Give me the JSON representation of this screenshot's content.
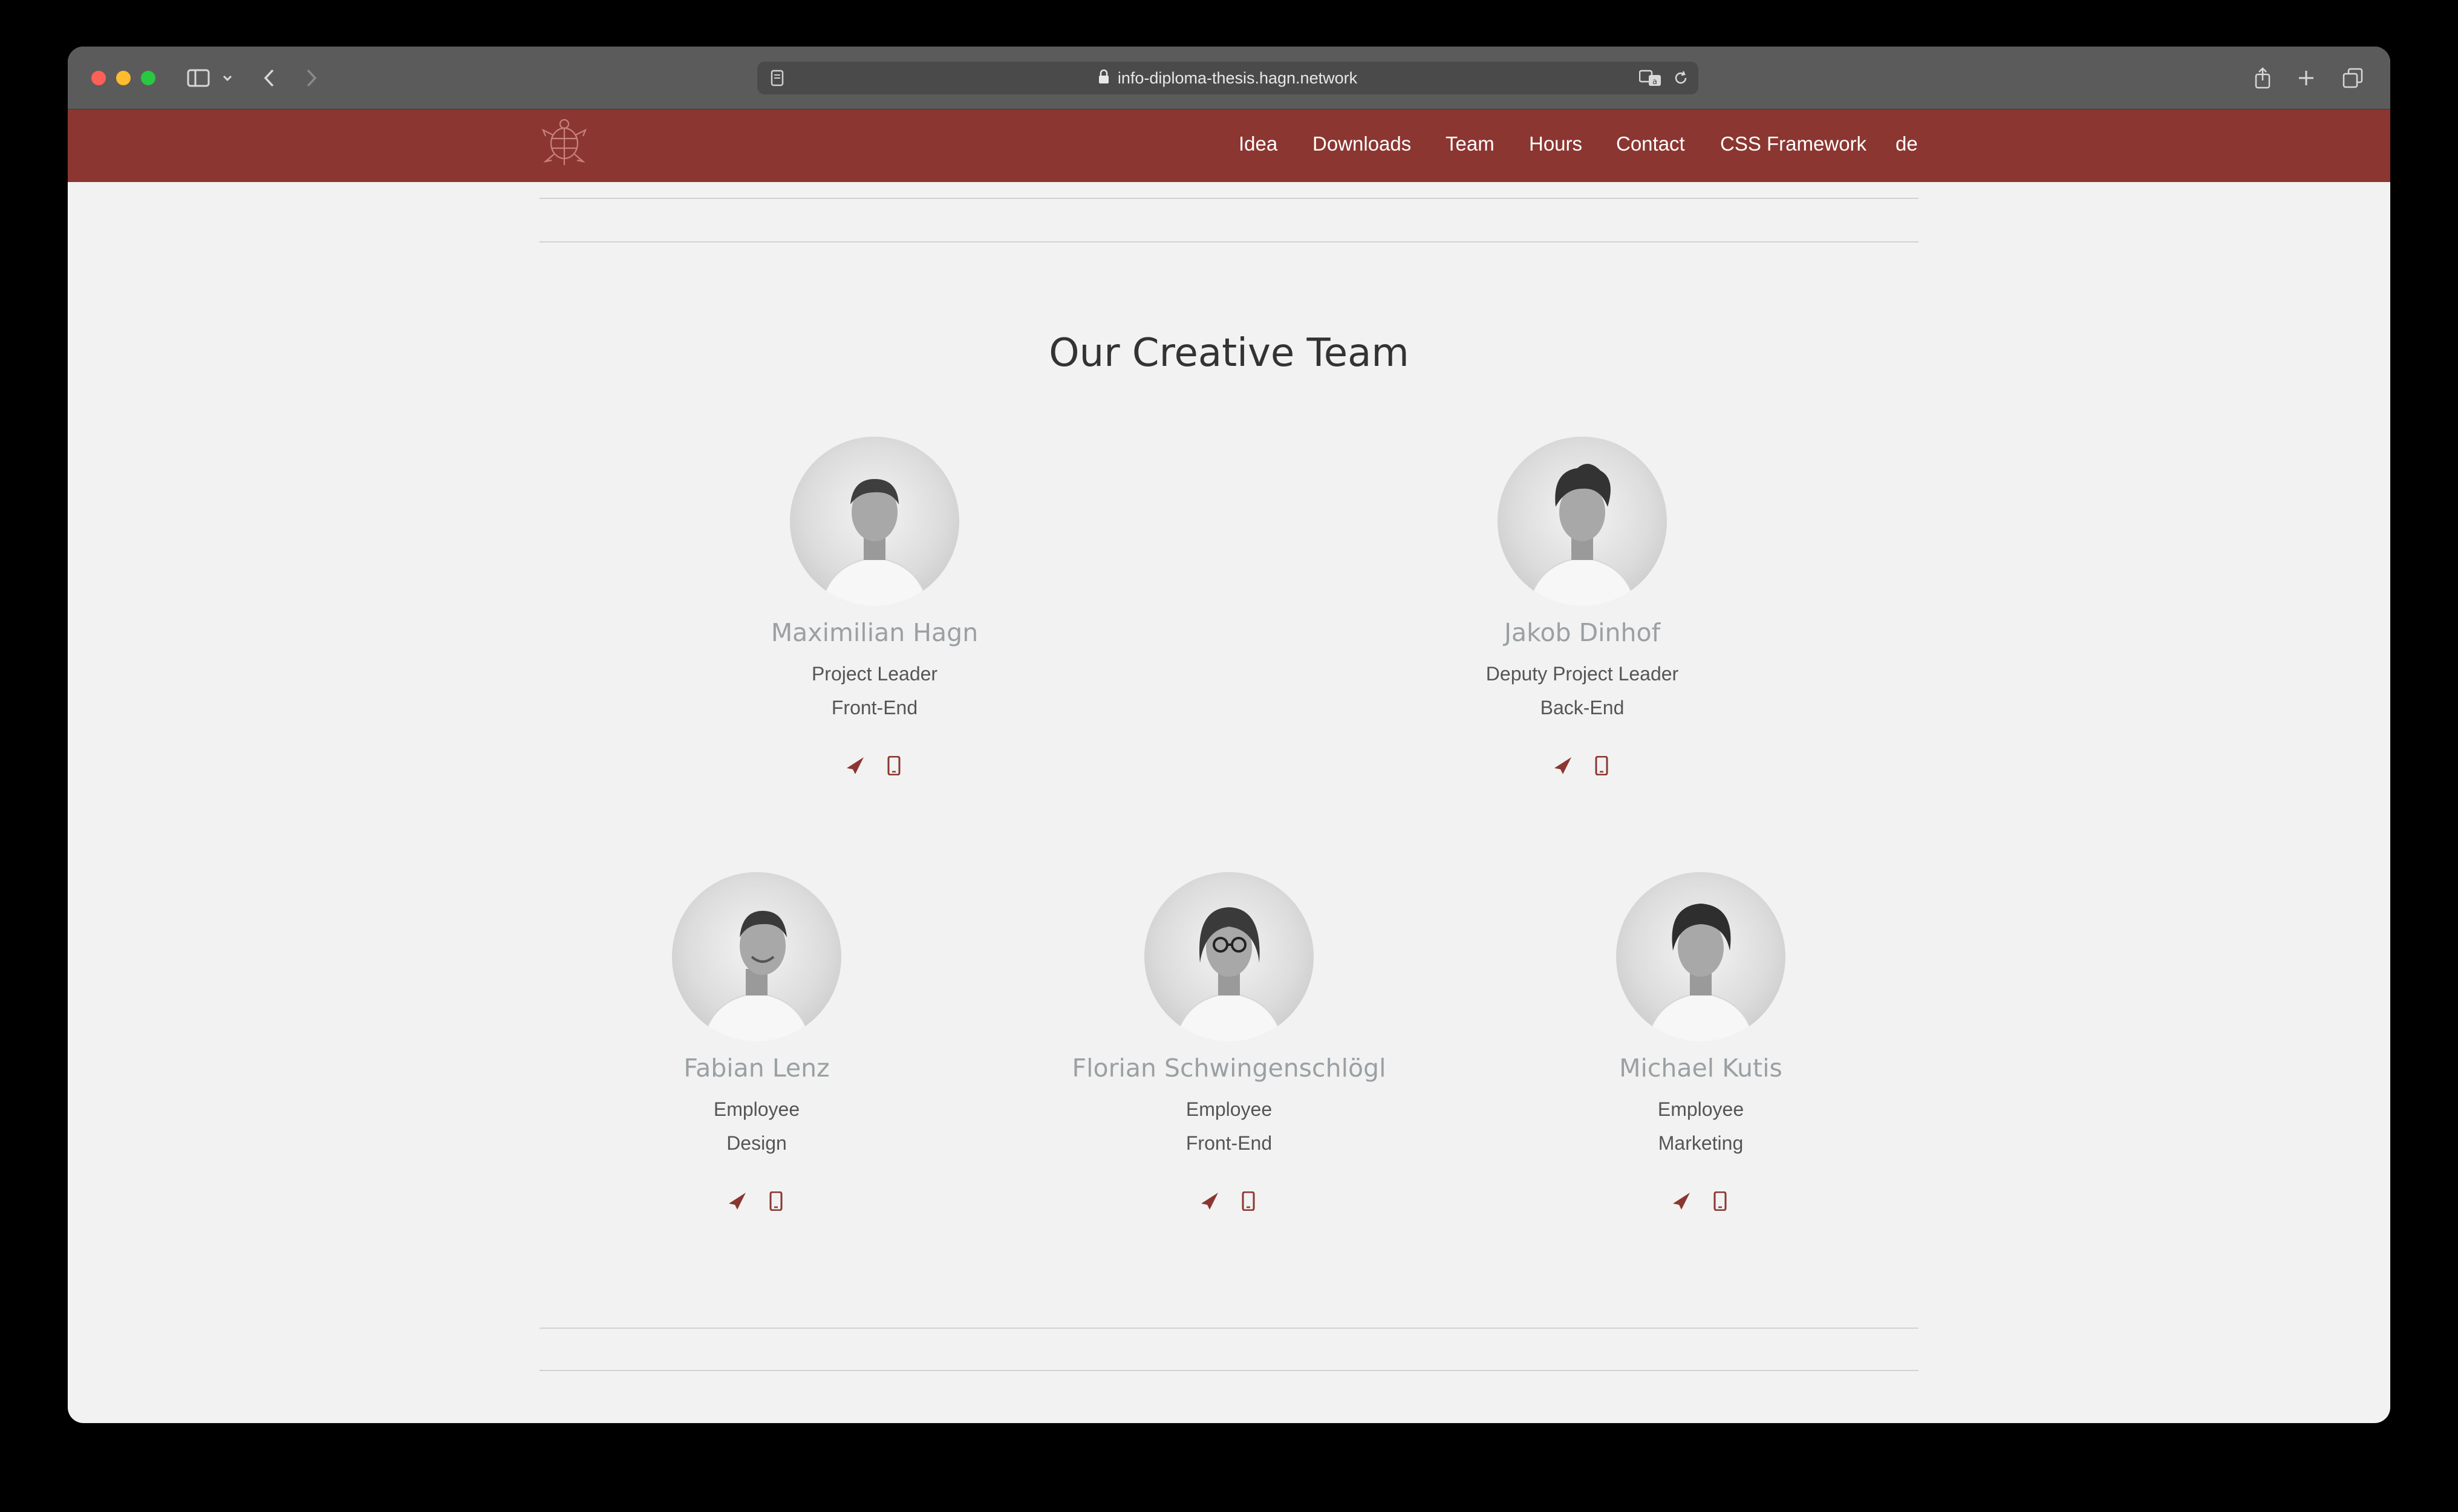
{
  "browser": {
    "url": "info-diploma-thesis.hagn.network",
    "icons": {
      "sidebar": "sidebar-icon",
      "back": "chevron-left-icon",
      "forward": "chevron-right-icon",
      "share": "share-icon",
      "new_tab": "plus-icon",
      "tabs": "tab-overview-icon"
    }
  },
  "nav": {
    "links": [
      "Idea",
      "Downloads",
      "Team",
      "Hours",
      "Contact",
      "CSS Framework",
      "de"
    ]
  },
  "team": {
    "title": "Our Creative Team",
    "members": [
      {
        "name": "Maximilian Hagn",
        "role": "Project Leader",
        "area": "Front-End"
      },
      {
        "name": "Jakob Dinhof",
        "role": "Deputy Project Leader",
        "area": "Back-End"
      },
      {
        "name": "Fabian Lenz",
        "role": "Employee",
        "area": "Design"
      },
      {
        "name": "Florian Schwingenschlögl",
        "role": "Employee",
        "area": "Front-End"
      },
      {
        "name": "Michael Kutis",
        "role": "Employee",
        "area": "Marketing"
      }
    ]
  },
  "colors": {
    "brand": "#8b3631",
    "background": "#f2f2f2",
    "name_text": "#9aa0a3",
    "body_text": "#555555"
  }
}
